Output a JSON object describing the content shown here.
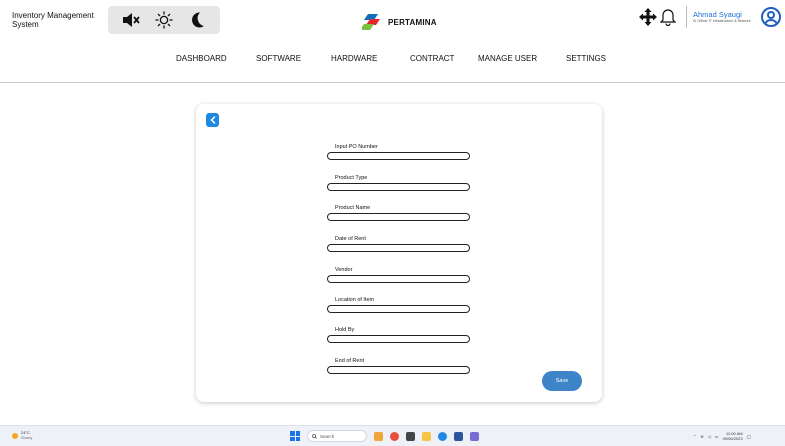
{
  "header": {
    "app_title": "Inventory Management System",
    "brand": "PERTAMINA",
    "mode_icons": [
      "speaker-muted-icon",
      "sun-icon",
      "moon-icon"
    ],
    "tool_icons": [
      "move-arrows-icon",
      "bell-icon"
    ],
    "user": {
      "name": "Ahmad Syaugi",
      "role": "Sr Officer IT Infrastructure & Network"
    }
  },
  "nav": {
    "items": [
      "DASHBOARD",
      "SOFTWARE",
      "HARDWARE",
      "CONTRACT",
      "MANAGE USER",
      "SETTINGS"
    ]
  },
  "form": {
    "fields": [
      {
        "label": "Input PO Number",
        "value": ""
      },
      {
        "label": "Product Type",
        "value": ""
      },
      {
        "label": "Product Name",
        "value": ""
      },
      {
        "label": "Date of Rent",
        "value": ""
      },
      {
        "label": "Vendor",
        "value": ""
      },
      {
        "label": "Location of Item",
        "value": ""
      },
      {
        "label": "Hold By",
        "value": ""
      },
      {
        "label": "End of Rent",
        "value": ""
      }
    ],
    "save_label": "Save"
  },
  "taskbar": {
    "weather_temp": "24°C",
    "weather_condition": "Sunny",
    "search_placeholder": "Search",
    "time": "11:00 AM",
    "date": "09/06/2023"
  },
  "colors": {
    "accent": "#1e88e5",
    "save_button": "#3e84c9",
    "user_name": "#1f6fd6",
    "brand_red": "#e3262d",
    "brand_green": "#7ac142",
    "brand_blue": "#0e6fb8"
  }
}
